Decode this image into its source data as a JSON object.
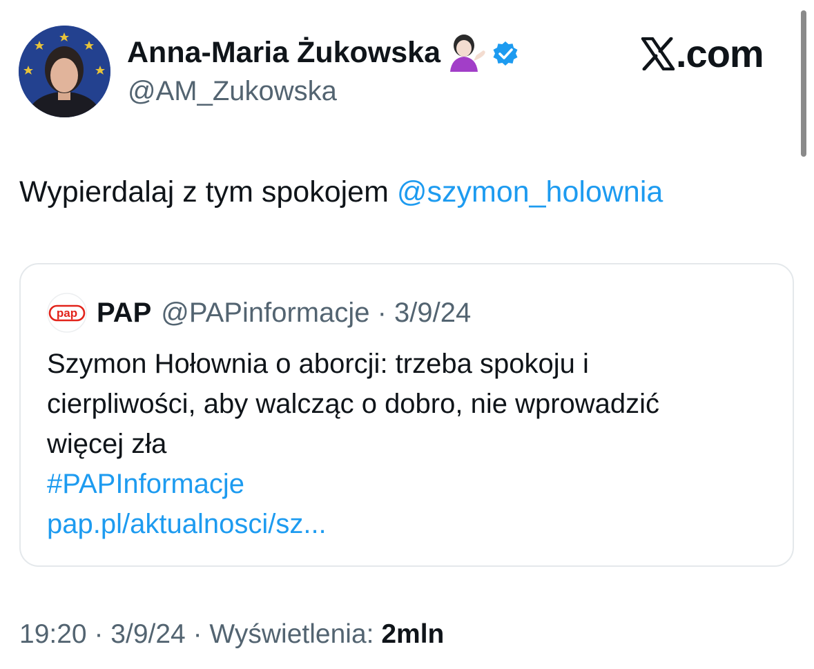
{
  "author": {
    "name": "Anna-Maria Żukowska",
    "handle": "@AM_Zukowska",
    "emoji_icon": "woman-tipping-hand-icon",
    "verified_icon": "verified-badge-icon"
  },
  "brand": {
    "logo_icon": "x-logo-icon",
    "text": ".com"
  },
  "tweet": {
    "text": "Wypierdalaj z tym spokojem ",
    "mention": "@szymon_holownia"
  },
  "quote": {
    "logo_icon": "pap-logo-icon",
    "logo_text": "pap",
    "name": "PAP",
    "handle": "@PAPinformacje",
    "separator": "·",
    "date": "3/9/24",
    "lines": [
      "Szymon Hołownia o aborcji: trzeba spokoju i",
      "cierpliwości, aby walcząc o dobro, nie wprowadzić",
      "więcej zła"
    ],
    "hashtag": "#PAPInformacje",
    "link": "pap.pl/aktualnosci/sz..."
  },
  "meta": {
    "time": "19:20",
    "separator": "·",
    "date": "3/9/24",
    "views_label": "Wyświetlenia:",
    "views_value": "2mln"
  },
  "colors": {
    "accent": "#1d9bf0",
    "secondary_text": "#536471",
    "primary_text": "#0f1419",
    "pap_red": "#e2231a"
  }
}
